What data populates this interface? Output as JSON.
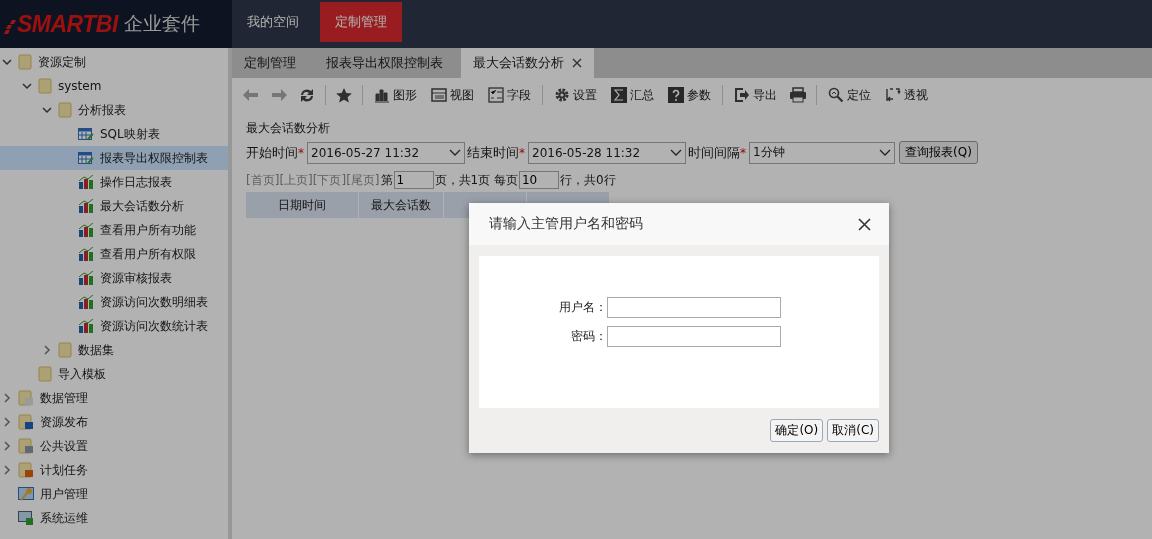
{
  "header": {
    "logo": "SMARTBI",
    "product": "企业套件",
    "nav": [
      {
        "label": "我的空间",
        "selected": false
      },
      {
        "label": "定制管理",
        "selected": true
      }
    ]
  },
  "sidebar": {
    "tree": [
      {
        "label": "资源定制",
        "kind": "folder",
        "expanded": true,
        "selected": false,
        "children": [
          {
            "label": "system",
            "kind": "folder",
            "expanded": true,
            "selected": false,
            "children": [
              {
                "label": "分析报表",
                "kind": "folder",
                "expanded": true,
                "selected": false,
                "children": [
                  {
                    "label": "SQL映射表",
                    "kind": "table",
                    "selected": false
                  },
                  {
                    "label": "报表导出权限控制表",
                    "kind": "table",
                    "selected": true
                  },
                  {
                    "label": "操作日志报表",
                    "kind": "chart",
                    "selected": false
                  },
                  {
                    "label": "最大会话数分析",
                    "kind": "chart",
                    "selected": false
                  },
                  {
                    "label": "查看用户所有功能",
                    "kind": "chart",
                    "selected": false
                  },
                  {
                    "label": "查看用户所有权限",
                    "kind": "chart",
                    "selected": false
                  },
                  {
                    "label": "资源审核报表",
                    "kind": "chart",
                    "selected": false
                  },
                  {
                    "label": "资源访问次数明细表",
                    "kind": "chart",
                    "selected": false
                  },
                  {
                    "label": "资源访问次数统计表",
                    "kind": "chart",
                    "selected": false
                  }
                ]
              },
              {
                "label": "数据集",
                "kind": "folder",
                "expanded": false,
                "selected": false
              }
            ]
          },
          {
            "label": "导入模板",
            "kind": "folder",
            "selected": false
          }
        ]
      },
      {
        "label": "数据管理",
        "kind": "data",
        "expanded": false,
        "selected": false
      },
      {
        "label": "资源发布",
        "kind": "publish",
        "expanded": false,
        "selected": false
      },
      {
        "label": "公共设置",
        "kind": "settings",
        "expanded": false,
        "selected": false
      },
      {
        "label": "计划任务",
        "kind": "task",
        "expanded": false,
        "selected": false
      },
      {
        "label": "用户管理",
        "kind": "users",
        "selected": false
      },
      {
        "label": "系统运维",
        "kind": "system",
        "selected": false
      }
    ]
  },
  "tabs": [
    {
      "label": "定制管理",
      "selected": false,
      "closable": false
    },
    {
      "label": "报表导出权限控制表",
      "selected": false,
      "closable": false
    },
    {
      "label": "最大会话数分析",
      "selected": true,
      "closable": true
    }
  ],
  "toolbar": [
    {
      "kind": "back",
      "disabled": true
    },
    {
      "kind": "forward",
      "disabled": true
    },
    {
      "kind": "refresh",
      "disabled": false
    },
    {
      "kind": "sep"
    },
    {
      "kind": "star",
      "disabled": false
    },
    {
      "kind": "sep"
    },
    {
      "kind": "chart",
      "label": "图形"
    },
    {
      "kind": "view",
      "label": "视图"
    },
    {
      "kind": "fields",
      "label": "字段"
    },
    {
      "kind": "sep"
    },
    {
      "kind": "gear",
      "label": "设置"
    },
    {
      "kind": "sum",
      "label": "汇总"
    },
    {
      "kind": "help",
      "label": "参数"
    },
    {
      "kind": "sep"
    },
    {
      "kind": "export",
      "label": "导出"
    },
    {
      "kind": "print",
      "disabled": false
    },
    {
      "kind": "sep"
    },
    {
      "kind": "locate",
      "label": "定位"
    },
    {
      "kind": "pivot",
      "label": "透视"
    }
  ],
  "report": {
    "title": "最大会话数分析",
    "params": [
      {
        "label": "开始时间",
        "required_mark": "*",
        "value": "2016-05-27 11:32"
      },
      {
        "label": "结束时间",
        "required_mark": "*",
        "value": "2016-05-28 11:32"
      },
      {
        "label": "时间间隔",
        "required_mark": "*",
        "value": "1分钟"
      }
    ],
    "query_button": "查询报表(Q)",
    "pager": {
      "links": [
        "[首页]",
        "[上页]",
        "[下页]",
        "[尾页]"
      ],
      "page_prefix": "第",
      "page": "1",
      "page_suffix": "页，共1页 每页",
      "rows": "10",
      "rows_suffix": "行，共0行"
    },
    "columns": [
      "日期时间",
      "最大会话数"
    ]
  },
  "dialog": {
    "title": "请输入主管用户名和密码",
    "fields": [
      {
        "label": "用户名："
      },
      {
        "label": "密码："
      }
    ],
    "buttons": [
      "确定(O)",
      "取消(C)"
    ]
  }
}
